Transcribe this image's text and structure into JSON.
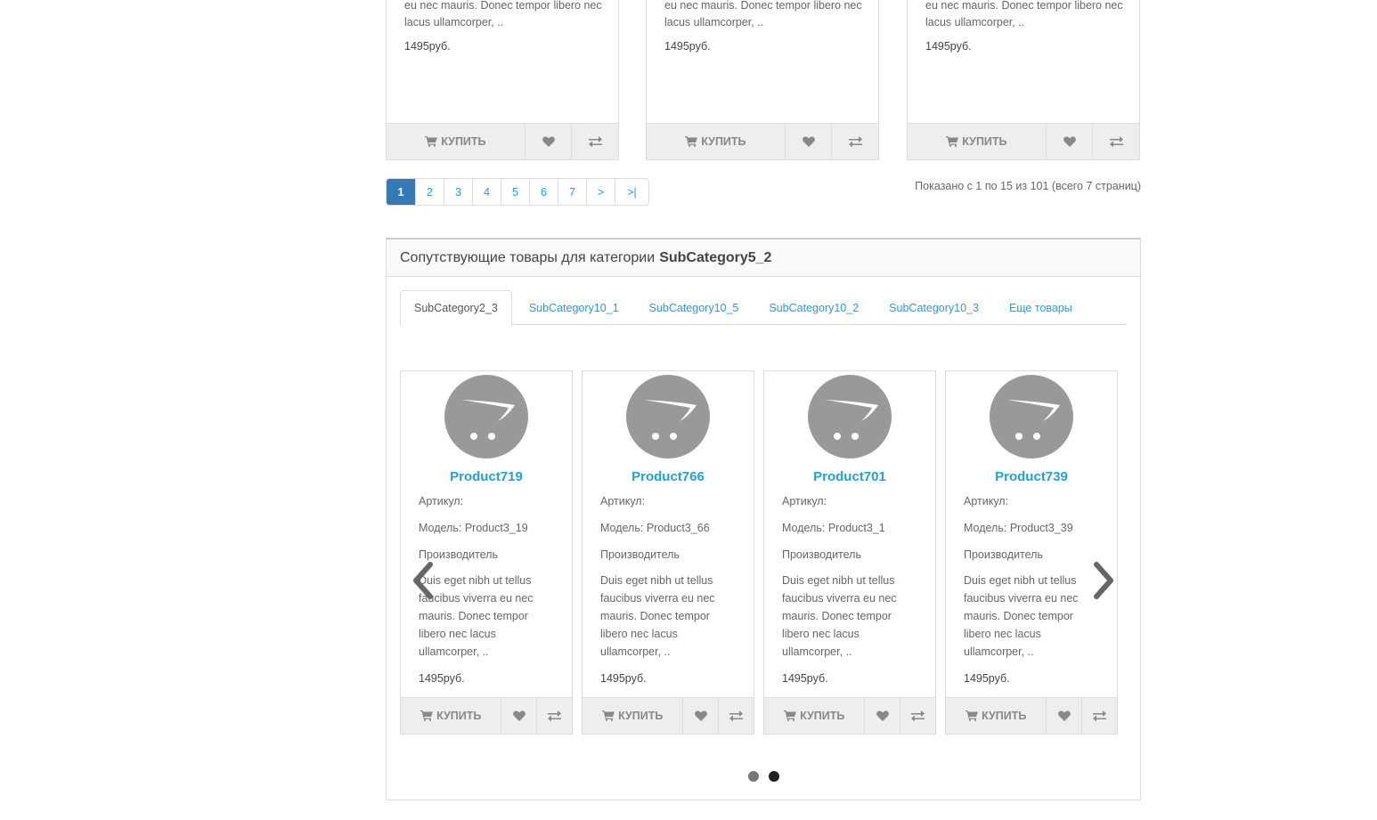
{
  "top_cards": [
    {
      "desc": "eu nec mauris. Donec tempor libero nec lacus ullamcorper, ..",
      "price": "1495руб.",
      "buy_label": "КУПИТЬ"
    },
    {
      "desc": "eu nec mauris. Donec tempor libero nec lacus ullamcorper, ..",
      "price": "1495руб.",
      "buy_label": "КУПИТЬ"
    },
    {
      "desc": "eu nec mauris. Donec tempor libero nec lacus ullamcorper, ..",
      "price": "1495руб.",
      "buy_label": "КУПИТЬ"
    }
  ],
  "pagination": {
    "pages": [
      "1",
      "2",
      "3",
      "4",
      "5",
      "6",
      "7",
      ">",
      ">|"
    ],
    "active": "1",
    "results_text": "Показано с 1 по 15 из 101 (всего 7 страниц)"
  },
  "related": {
    "heading_prefix": "Сопутствующие товары для категории",
    "heading_category": "SubCategory5_2",
    "tabs": [
      "SubCategory2_3",
      "SubCategory10_1",
      "SubCategory10_5",
      "SubCategory10_2",
      "SubCategory10_3",
      "Еще товары"
    ],
    "active_tab": "SubCategory2_3",
    "products": [
      {
        "name": "Product719",
        "sku_label": "Артикул:",
        "model": "Модель: Product3_19",
        "manufacturer": "Производитель",
        "desc": "Duis eget nibh ut tellus faucibus viverra eu nec mauris. Donec tempor libero nec lacus ullamcorper, ..",
        "price": "1495руб.",
        "buy_label": "КУПИТЬ"
      },
      {
        "name": "Product766",
        "sku_label": "Артикул:",
        "model": "Модель: Product3_66",
        "manufacturer": "Производитель",
        "desc": "Duis eget nibh ut tellus faucibus viverra eu nec mauris. Donec tempor libero nec lacus ullamcorper, ..",
        "price": "1495руб.",
        "buy_label": "КУПИТЬ"
      },
      {
        "name": "Product701",
        "sku_label": "Артикул:",
        "model": "Модель: Product3_1",
        "manufacturer": "Производитель",
        "desc": "Duis eget nibh ut tellus faucibus viverra eu nec mauris. Donec tempor libero nec lacus ullamcorper, ..",
        "price": "1495руб.",
        "buy_label": "КУПИТЬ"
      },
      {
        "name": "Product739",
        "sku_label": "Артикул:",
        "model": "Модель: Product3_39",
        "manufacturer": "Производитель",
        "desc": "Duis eget nibh ut tellus faucibus viverra eu nec mauris. Donec tempor libero nec lacus ullamcorper, ..",
        "price": "1495руб.",
        "buy_label": "КУПИТЬ"
      }
    ],
    "carousel_dots": 2,
    "active_dot": 2
  },
  "colors": {
    "link": "#23a1d1",
    "pagination_active": "#337ab7",
    "button_bg": "#eeeeee"
  },
  "icons": [
    "cart-icon",
    "heart-icon",
    "compare-icon",
    "opencart-logo-icon",
    "chevron-left-icon",
    "chevron-right-icon"
  ]
}
